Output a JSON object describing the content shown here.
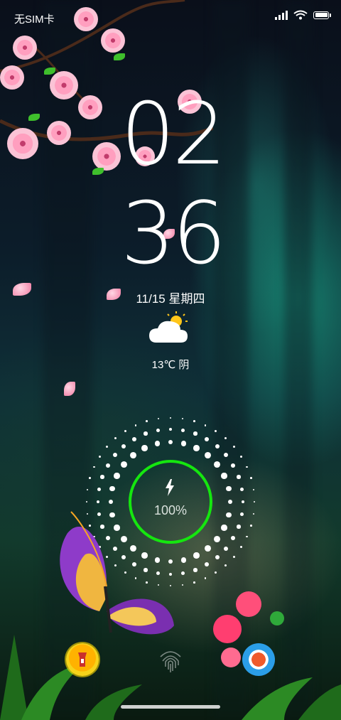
{
  "status_bar": {
    "carrier": "无SIM卡",
    "icons": [
      "signal-icon",
      "wifi-icon",
      "battery-icon"
    ]
  },
  "clock": {
    "hour": "02",
    "minute": "36"
  },
  "date": "11/15  星期四",
  "weather": {
    "icon": "partly-cloudy-icon",
    "temp_text": "13℃  阴"
  },
  "charging": {
    "percent_text": "100%",
    "level": 1.0,
    "ring_color": "#15e60f",
    "icon": "lightning-bolt-icon"
  },
  "shortcuts": {
    "left": "flashlight-icon",
    "center": "fingerprint-icon",
    "right": "camera-icon"
  },
  "colors": {
    "accent_green": "#15e60f",
    "torch_yellow": "#f6d31a",
    "camera_blue": "#2b9ee8"
  }
}
